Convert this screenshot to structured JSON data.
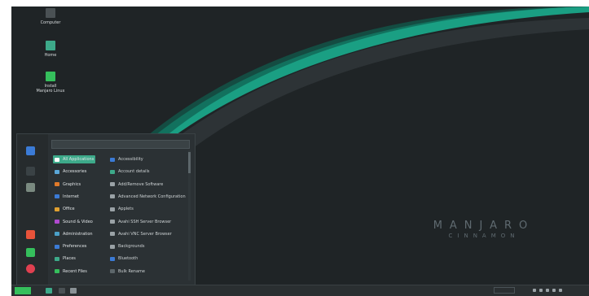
{
  "desktop": {
    "icons": [
      {
        "label": "Computer",
        "icon": "computer-icon",
        "color": "#4a5154"
      },
      {
        "label": "Home",
        "icon": "home-folder-icon",
        "color": "#3daa8a"
      },
      {
        "label": "Install Manjaro Linux",
        "icon": "installer-icon",
        "color": "#35bf5c"
      }
    ],
    "branding": {
      "line1": "MANJARO",
      "line2": "CINNAMON"
    }
  },
  "menu": {
    "search_placeholder": "",
    "sidebar": [
      {
        "name": "browser-icon",
        "color": "#3b7bd6"
      },
      {
        "name": "terminal-icon",
        "color": "#3a4245"
      },
      {
        "name": "files-icon",
        "color": "#7a8a80"
      },
      {
        "name": "lock-icon",
        "color": "#e8533a"
      },
      {
        "name": "logout-icon",
        "color": "#35bf5c"
      },
      {
        "name": "power-icon",
        "color": "#e04050"
      }
    ],
    "categories": [
      {
        "label": "All Applications",
        "color": "#3daa8a",
        "active": true
      },
      {
        "label": "Accessories",
        "color": "#5aa7d8",
        "active": false
      },
      {
        "label": "Graphics",
        "color": "#e07a2a",
        "active": false
      },
      {
        "label": "Internet",
        "color": "#3b7bd6",
        "active": false
      },
      {
        "label": "Office",
        "color": "#e0a030",
        "active": false
      },
      {
        "label": "Sound & Video",
        "color": "#b04ad0",
        "active": false
      },
      {
        "label": "Administration",
        "color": "#4aa0c8",
        "active": false
      },
      {
        "label": "Preferences",
        "color": "#3b7bd6",
        "active": false
      },
      {
        "label": "Places",
        "color": "#3daa8a",
        "active": false
      },
      {
        "label": "Recent Files",
        "color": "#35bf5c",
        "active": false
      }
    ],
    "apps": [
      {
        "label": "Accessibility",
        "color": "#3b7bd6"
      },
      {
        "label": "Account details",
        "color": "#3daa8a"
      },
      {
        "label": "Add/Remove Software",
        "color": "#9aa2a6"
      },
      {
        "label": "Advanced Network Configuration",
        "color": "#9aa2a6"
      },
      {
        "label": "Applets",
        "color": "#9aa2a6"
      },
      {
        "label": "Avahi SSH Server Browser",
        "color": "#9aa2a6"
      },
      {
        "label": "Avahi VNC Server Browser",
        "color": "#9aa2a6"
      },
      {
        "label": "Backgrounds",
        "color": "#9aa2a6"
      },
      {
        "label": "Bluetooth",
        "color": "#3b7bd6"
      },
      {
        "label": "Bulk Rename",
        "color": "#5c666a"
      }
    ]
  },
  "panel": {
    "launchers": [
      {
        "name": "files-icon",
        "color": "#3daa8a"
      },
      {
        "name": "terminal-icon",
        "color": "#4a5154"
      },
      {
        "name": "settings-icon",
        "color": "#8a9296"
      }
    ],
    "tray": [
      "network-icon",
      "volume-icon",
      "battery-icon",
      "notifications-icon",
      "clock-icon"
    ]
  },
  "colors": {
    "accent": "#3daa8a",
    "desktop_bg": "#1f2426"
  }
}
